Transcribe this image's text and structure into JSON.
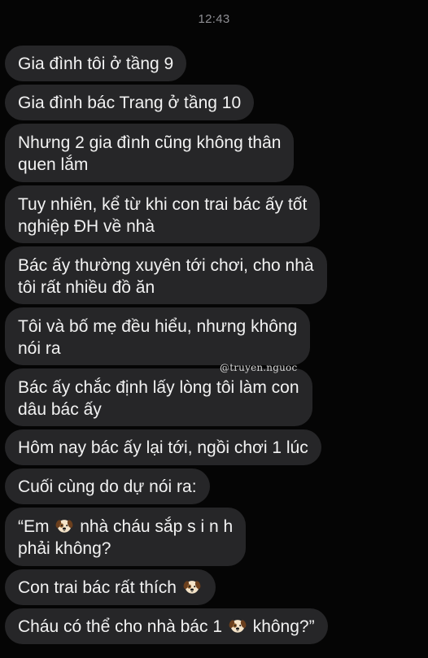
{
  "status": {
    "time": "12:43"
  },
  "messages": [
    {
      "lines": [
        "Gia đình tôi ở tầng 9"
      ]
    },
    {
      "lines": [
        "Gia đình bác Trang ở tầng 10"
      ]
    },
    {
      "lines": [
        "Nhưng 2 gia đình cũng không thân",
        "quen lắm"
      ]
    },
    {
      "lines": [
        "Tuy nhiên, kể từ khi con trai bác ấy tốt",
        "nghiệp ĐH về nhà"
      ]
    },
    {
      "lines": [
        "Bác ấy thường xuyên tới chơi, cho nhà",
        "tôi rất nhiều đồ ăn"
      ]
    },
    {
      "lines": [
        "Tôi và bố mẹ đều hiểu, nhưng không",
        "nói ra"
      ]
    },
    {
      "lines": [
        "Bác ấy chắc định lấy lòng tôi làm con",
        "dâu bác ấy"
      ]
    },
    {
      "lines": [
        "Hôm nay bác ấy lại tới, ngồi chơi 1 lúc"
      ]
    },
    {
      "lines": [
        "Cuối cùng do dự nói ra:"
      ]
    },
    {
      "line1_before": "“Em",
      "line1_after": "nhà cháu sắp s i n h",
      "line2": "phải không?"
    },
    {
      "before": "Con trai bác rất thích",
      "after": ""
    },
    {
      "before": "Cháu có thể cho nhà bác 1",
      "after": "không?”"
    }
  ],
  "icons": {
    "emoji": "dog-face-icon"
  },
  "watermark": "@truyen.nguoc"
}
